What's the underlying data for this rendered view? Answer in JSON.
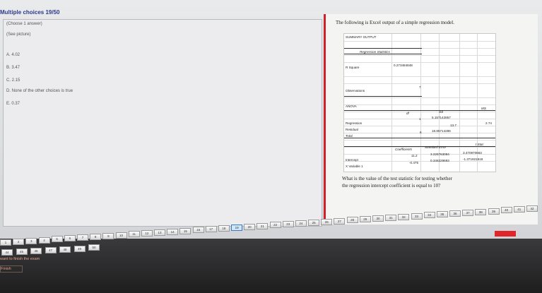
{
  "header": {
    "title": "Multiple choices 19/50"
  },
  "left": {
    "instruction": "(Choose 1 answer)",
    "see_picture": "(See picture)",
    "choices": [
      "A. 4.02",
      "B. 3.47",
      "C. 2.15",
      "D. None of the other choices is true",
      "E. 0.37"
    ]
  },
  "question": {
    "intro": "The following is Excel output of a simple regression model.",
    "prompt_line1": "What is the value of the test statistic for testing whether",
    "prompt_line2": "the regression intercept coefficient is equal to 10?"
  },
  "excel": {
    "summary_title": "SUMMARY OUTPUT",
    "reg_stats_title": "Regression Statistics",
    "r_square_label": "R Square",
    "r_square_value": "0.273484848",
    "observations_label": "Observations",
    "observations_value": "7",
    "anova_title": "ANOVA",
    "anova_headers": [
      "df",
      "SS",
      "MS"
    ],
    "regression_label": "Regression",
    "regression_df": "1",
    "regression_ss": "5.157142857",
    "residual_label": "Residual",
    "residual_ss": "13.7",
    "residual_ms": "2.74",
    "total_label": "Total",
    "total_df": "6",
    "total_ss": "18.85714286",
    "coef_headers": [
      "Coefficients",
      "Standard Error",
      "t Stat"
    ],
    "intercept_label": "Intercept",
    "intercept_coef": "11.2",
    "intercept_se": "3.226763084",
    "intercept_t": "3.470970663",
    "xvar_label": "X Variable 1",
    "xvar_coef": "-0.475",
    "xvar_se": "0.346229693",
    "xvar_t": "-1.371921618"
  },
  "nav": {
    "row1": [
      "1",
      "2",
      "3",
      "4",
      "5",
      "6",
      "7",
      "8",
      "9",
      "10",
      "11",
      "12",
      "13",
      "14",
      "15",
      "16",
      "17",
      "18",
      "19",
      "20",
      "21",
      "22",
      "23",
      "24",
      "25",
      "26",
      "27",
      "28",
      "29",
      "30",
      "31",
      "32",
      "33",
      "34",
      "35",
      "36",
      "37",
      "38",
      "39",
      "40",
      "41",
      "42"
    ],
    "row2": [
      "44",
      "45",
      "46",
      "47",
      "48",
      "49",
      "50"
    ],
    "current": "19",
    "finish_hint": "want to finish the exam",
    "finish_label": "Finish"
  },
  "colors": {
    "accent_red": "#d0202a",
    "title_blue": "#2b3a8a"
  }
}
